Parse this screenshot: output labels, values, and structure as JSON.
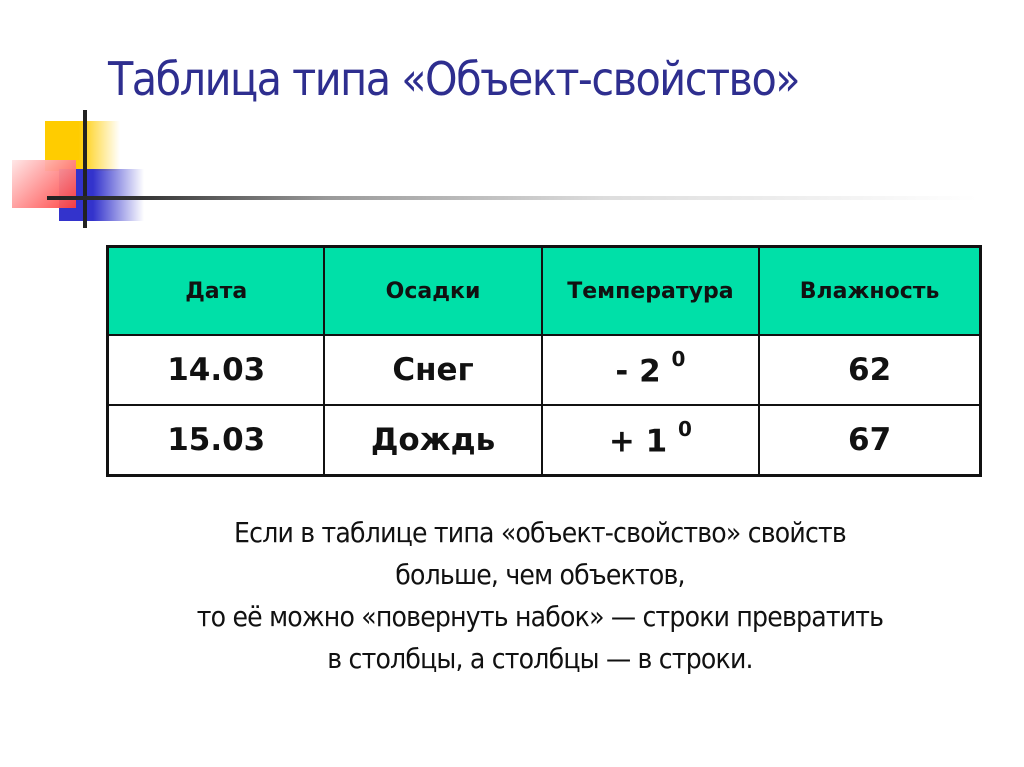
{
  "slide": {
    "title": "Таблица типа «Объект-свойство»",
    "title_color": "#2e2e8f",
    "header_color": "#00e0a8"
  },
  "table": {
    "headers": [
      "Дата",
      "Осадки",
      "Температура",
      "Влажность"
    ],
    "rows": [
      {
        "date": "14.03",
        "precip": "Снег",
        "temp": "- 2",
        "temp_unit": "0",
        "humidity": "62"
      },
      {
        "date": "15.03",
        "precip": "Дождь",
        "temp": "+ 1",
        "temp_unit": "0",
        "humidity": "67"
      }
    ]
  },
  "note": {
    "lines": [
      "Если в таблице типа «объект-свойство» свойств",
      "больше, чем объектов,",
      "то её можно «повернуть набок» — строки превратить",
      "в столбцы, а столбцы — в строки."
    ]
  }
}
